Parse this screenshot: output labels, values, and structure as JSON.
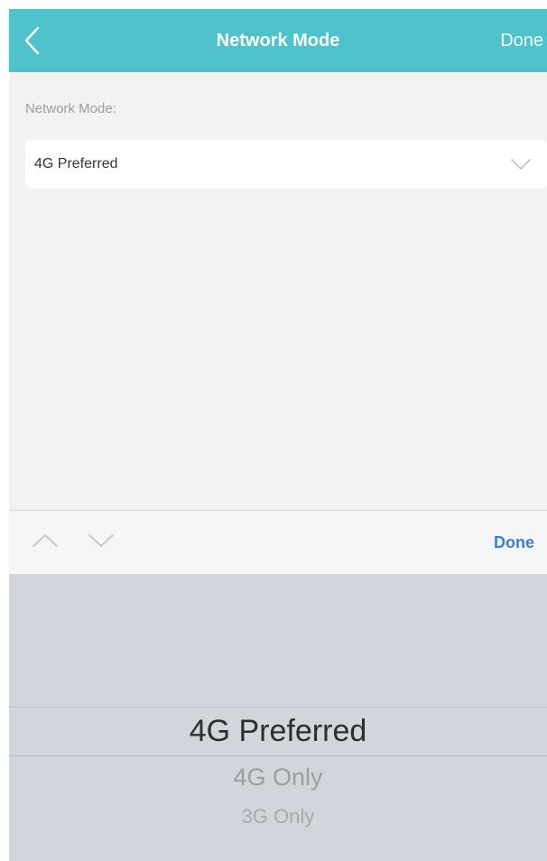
{
  "header": {
    "title": "Network Mode",
    "done_label": "Done",
    "back_icon": "chevron-left-icon",
    "background_color": "#4ec3cc"
  },
  "form": {
    "network_mode_label": "Network Mode:",
    "network_mode_value": "4G Preferred",
    "dropdown_icon": "chevron-down-icon"
  },
  "toolbar": {
    "prev_icon": "chevron-up-icon",
    "next_icon": "chevron-down-icon",
    "done_label": "Done",
    "done_color": "#3a7ed8"
  },
  "picker": {
    "options": [
      "4G Preferred",
      "4G Only",
      "3G Only"
    ],
    "selected": "4G Preferred"
  }
}
